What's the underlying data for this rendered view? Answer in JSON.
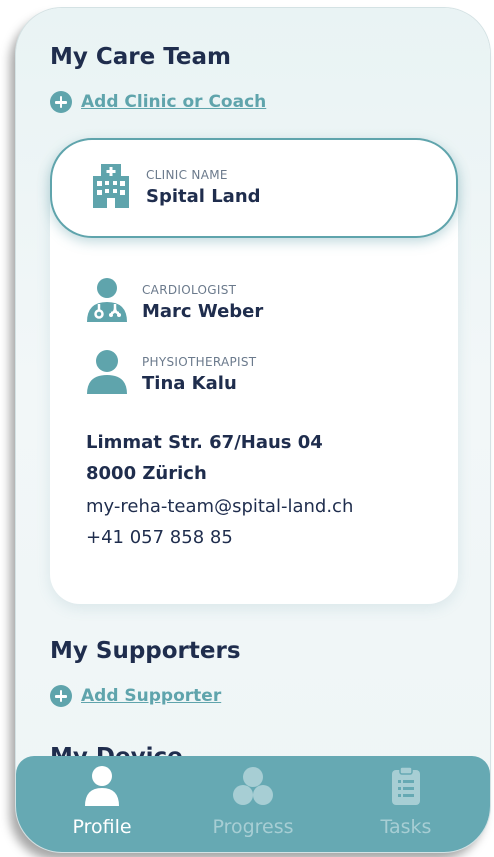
{
  "care_team": {
    "title": "My Care Team",
    "add_label": "Add Clinic or Coach"
  },
  "clinic": {
    "label": "CLINIC NAME",
    "name": "Spital Land"
  },
  "members": [
    {
      "role": "CARDIOLOGIST",
      "name": "Marc Weber",
      "icon": "doctor-icon"
    },
    {
      "role": "PHYSIOTHERAPIST",
      "name": "Tina Kalu",
      "icon": "person-icon"
    }
  ],
  "contact": {
    "street": "Limmat Str. 67/Haus 04",
    "city": "8000 Zürich",
    "email": "my-reha-team@spital-land.ch",
    "phone": "+41 057 858 85"
  },
  "supporters": {
    "title": "My Supporters",
    "add_label": "Add Supporter"
  },
  "devices": {
    "title": "My Device"
  },
  "nav": [
    {
      "label": "Profile",
      "icon": "profile-icon",
      "active": true
    },
    {
      "label": "Progress",
      "icon": "progress-icon",
      "active": false
    },
    {
      "label": "Tasks",
      "icon": "tasks-icon",
      "active": false
    }
  ],
  "colors": {
    "accent": "#5fa4ac",
    "nav_bg": "#66a9b3",
    "text": "#1f2d4d",
    "background": "#eef5f6"
  }
}
